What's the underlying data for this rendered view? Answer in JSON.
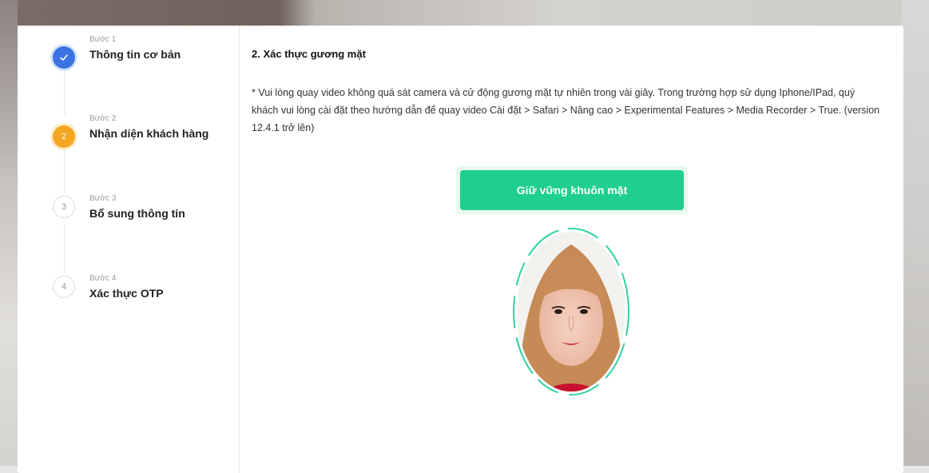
{
  "steps": [
    {
      "small": "Bước 1",
      "title": "Thông tin cơ bản",
      "state": "done"
    },
    {
      "small": "Bước 2",
      "title": "Nhận diện khách hàng",
      "state": "active",
      "number": "2"
    },
    {
      "small": "Bước 3",
      "title": "Bổ sung thông tin",
      "state": "pending",
      "number": "3"
    },
    {
      "small": "Bước 4",
      "title": "Xác thực OTP",
      "state": "pending",
      "number": "4"
    }
  ],
  "main": {
    "title": "2. Xác thực gương mặt",
    "description": "* Vui lòng quay video không quá sát camera và cử động gương mặt tự nhiên trong vài giây. Trong trường hợp sử dụng Iphone/IPad, quý khách vui lòng cài đặt theo hướng dẫn để quay video Cài đặt > Safari > Nâng cao > Experimental Features > Media Recorder > True. (version 12.4.1 trở lên)",
    "button_label": "Giữ vững khuôn mặt"
  },
  "colors": {
    "done": "#3b73e3",
    "active": "#f5a623",
    "button": "#1fcf8e",
    "face_guide": "#2ed3a0"
  }
}
